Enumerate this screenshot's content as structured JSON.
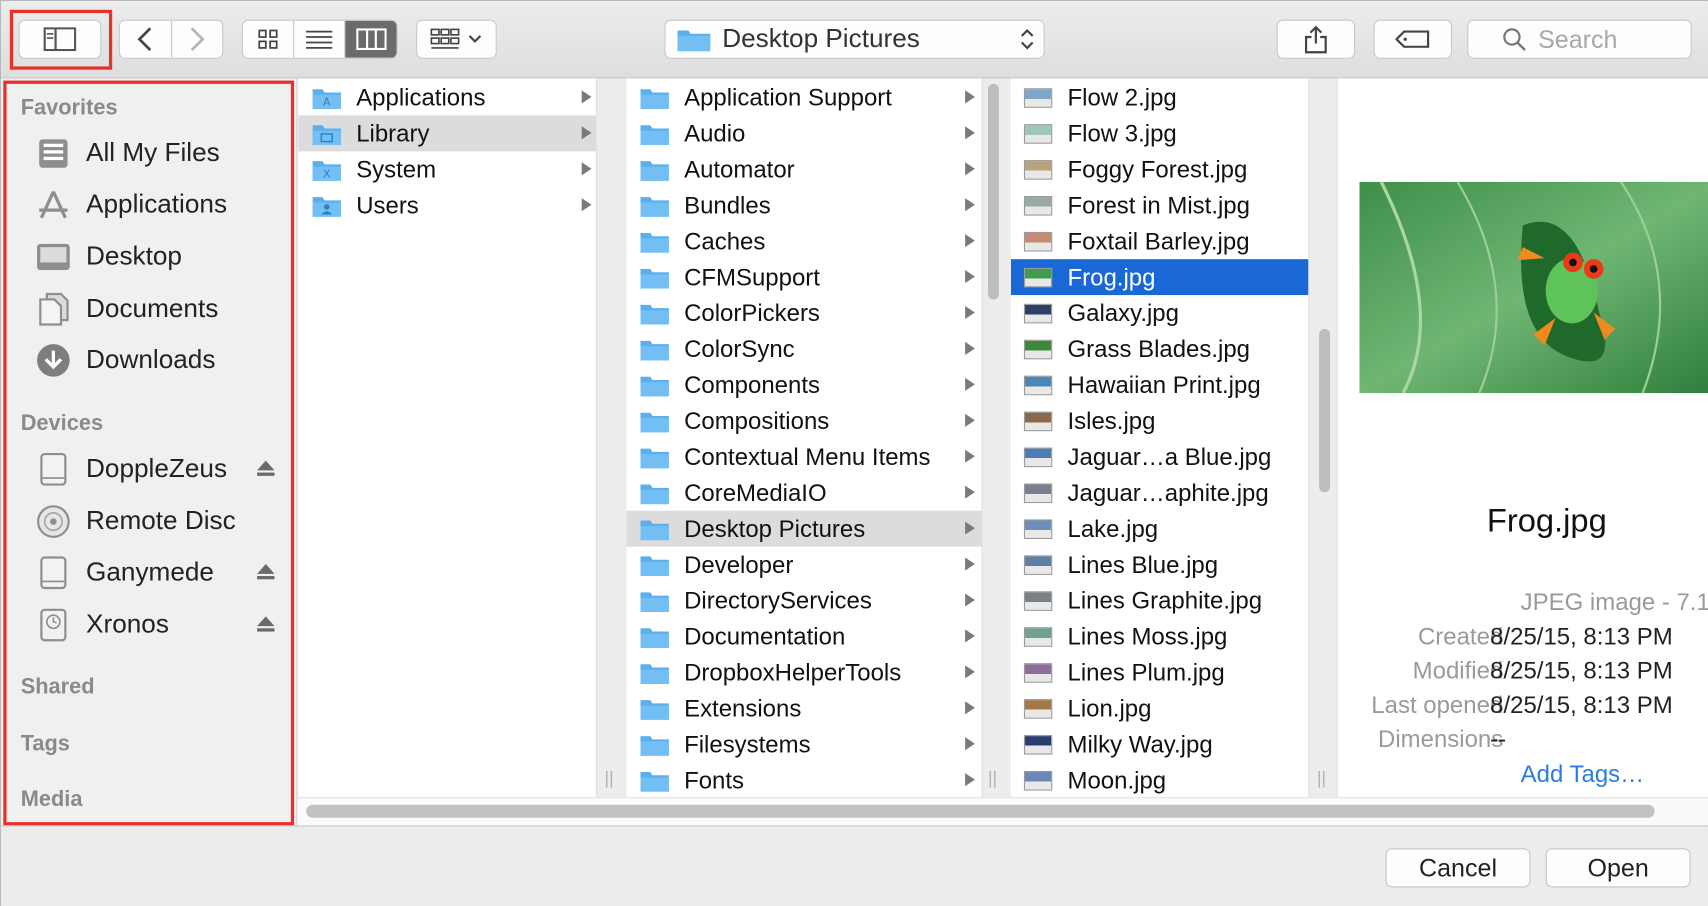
{
  "toolbar": {
    "path_label": "Desktop Pictures",
    "search_placeholder": "Search"
  },
  "sidebar": {
    "favorites_heading": "Favorites",
    "favorites": [
      {
        "label": "All My Files",
        "icon": "all-files-icon"
      },
      {
        "label": "Applications",
        "icon": "applications-icon"
      },
      {
        "label": "Desktop",
        "icon": "desktop-icon"
      },
      {
        "label": "Documents",
        "icon": "documents-icon"
      },
      {
        "label": "Downloads",
        "icon": "downloads-icon"
      }
    ],
    "devices_heading": "Devices",
    "devices": [
      {
        "label": "DoppleZeus",
        "icon": "disk-icon",
        "eject": true
      },
      {
        "label": "Remote Disc",
        "icon": "remote-disc-icon",
        "eject": false
      },
      {
        "label": "Ganymede",
        "icon": "disk-icon",
        "eject": true
      },
      {
        "label": "Xronos",
        "icon": "time-machine-icon",
        "eject": true
      }
    ],
    "shared_heading": "Shared",
    "tags_heading": "Tags",
    "media_heading": "Media"
  },
  "column1": [
    "Applications",
    "Library",
    "System",
    "Users"
  ],
  "column2": [
    "Application Support",
    "Audio",
    "Automator",
    "Bundles",
    "Caches",
    "CFMSupport",
    "ColorPickers",
    "ColorSync",
    "Components",
    "Compositions",
    "Contextual Menu Items",
    "CoreMediaIO",
    "Desktop Pictures",
    "Developer",
    "DirectoryServices",
    "Documentation",
    "DropboxHelperTools",
    "Extensions",
    "Filesystems",
    "Fonts"
  ],
  "column3": [
    "Flow 2.jpg",
    "Flow 3.jpg",
    "Foggy Forest.jpg",
    "Forest in Mist.jpg",
    "Foxtail Barley.jpg",
    "Frog.jpg",
    "Galaxy.jpg",
    "Grass Blades.jpg",
    "Hawaiian Print.jpg",
    "Isles.jpg",
    "Jaguar…a Blue.jpg",
    "Jaguar…aphite.jpg",
    "Lake.jpg",
    "Lines Blue.jpg",
    "Lines Graphite.jpg",
    "Lines Moss.jpg",
    "Lines Plum.jpg",
    "Lion.jpg",
    "Milky Way.jpg",
    "Moon.jpg"
  ],
  "preview": {
    "filename": "Frog.jpg",
    "kind": "JPEG image - 7.1",
    "created_label": "Created",
    "created_value": "8/25/15, 8:13 PM",
    "modified_label": "Modified",
    "modified_value": "8/25/15, 8:13 PM",
    "last_opened_label": "Last opened",
    "last_opened_value": "8/25/15, 8:13 PM",
    "dimensions_label": "Dimensions",
    "dimensions_value": "--",
    "add_tags": "Add Tags…"
  },
  "buttons": {
    "cancel": "Cancel",
    "open": "Open"
  },
  "colors": {
    "selection_blue": "#1a68d6",
    "highlight_red": "#e8312a",
    "folder_blue": "#5ab0ee",
    "link_blue": "#2a7ee0"
  }
}
